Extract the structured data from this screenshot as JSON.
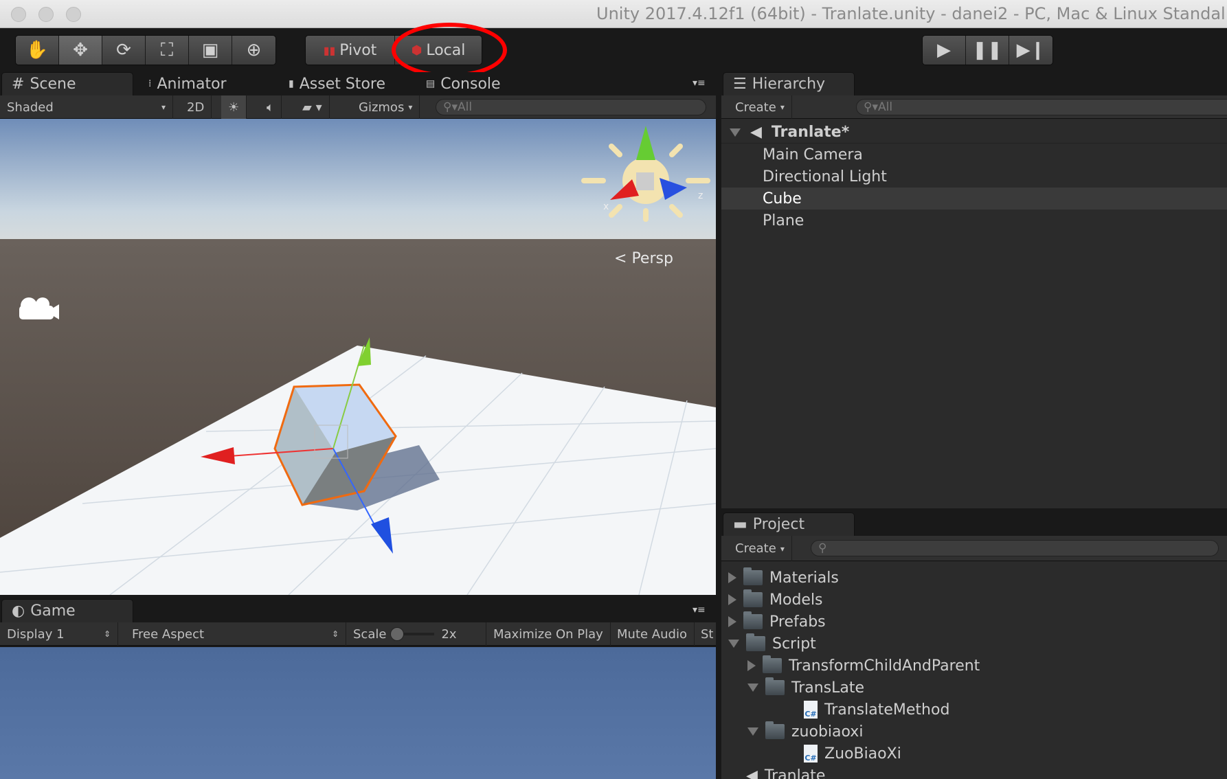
{
  "window": {
    "title": "Unity 2017.4.12f1 (64bit) - Tranlate.unity - danei2 - PC, Mac & Linux Standal"
  },
  "toolbar": {
    "tools": [
      "hand-icon",
      "move-icon",
      "rotate-icon",
      "scale-icon",
      "rect-icon",
      "transform-icon"
    ],
    "pivot": "Pivot",
    "local": "Local",
    "annotation_color": "#ff0000"
  },
  "scene_tabs": [
    {
      "label": "Scene",
      "icon": "grid-icon"
    },
    {
      "label": "Animator",
      "icon": "animator-icon"
    },
    {
      "label": "Asset Store",
      "icon": "store-icon"
    },
    {
      "label": "Console",
      "icon": "console-icon"
    }
  ],
  "scene_bar": {
    "shading": "Shaded",
    "mode2d": "2D",
    "gizmos": "Gizmos",
    "search_placeholder": "All",
    "persp": "Persp",
    "gizmo_axis_x": "x",
    "gizmo_axis_z": "z"
  },
  "game": {
    "tab": "Game",
    "display": "Display 1",
    "aspect": "Free Aspect",
    "scale_label": "Scale",
    "scale_value": "2x",
    "maximize": "Maximize On Play",
    "mute": "Mute Audio",
    "stats": "St"
  },
  "hierarchy": {
    "tab": "Hierarchy",
    "create": "Create",
    "search_placeholder": "All",
    "scene": "Tranlate*",
    "items": [
      "Main Camera",
      "Directional Light",
      "Cube",
      "Plane"
    ],
    "selected": "Cube"
  },
  "project": {
    "tab": "Project",
    "create": "Create",
    "items": [
      {
        "label": "Materials",
        "type": "folder",
        "depth": 0,
        "state": "collapsed"
      },
      {
        "label": "Models",
        "type": "folder",
        "depth": 0,
        "state": "collapsed"
      },
      {
        "label": "Prefabs",
        "type": "folder",
        "depth": 0,
        "state": "collapsed"
      },
      {
        "label": "Script",
        "type": "folder",
        "depth": 0,
        "state": "expanded"
      },
      {
        "label": "TransformChildAndParent",
        "type": "folder",
        "depth": 1,
        "state": "collapsed"
      },
      {
        "label": "TransLate",
        "type": "folder",
        "depth": 1,
        "state": "expanded"
      },
      {
        "label": "TranslateMethod",
        "type": "script",
        "depth": 2
      },
      {
        "label": "zuobiaoxi",
        "type": "folder",
        "depth": 1,
        "state": "expanded"
      },
      {
        "label": "ZuoBiaoXi",
        "type": "script",
        "depth": 2
      },
      {
        "label": "Tranlate",
        "type": "scene",
        "depth": 0
      }
    ]
  }
}
